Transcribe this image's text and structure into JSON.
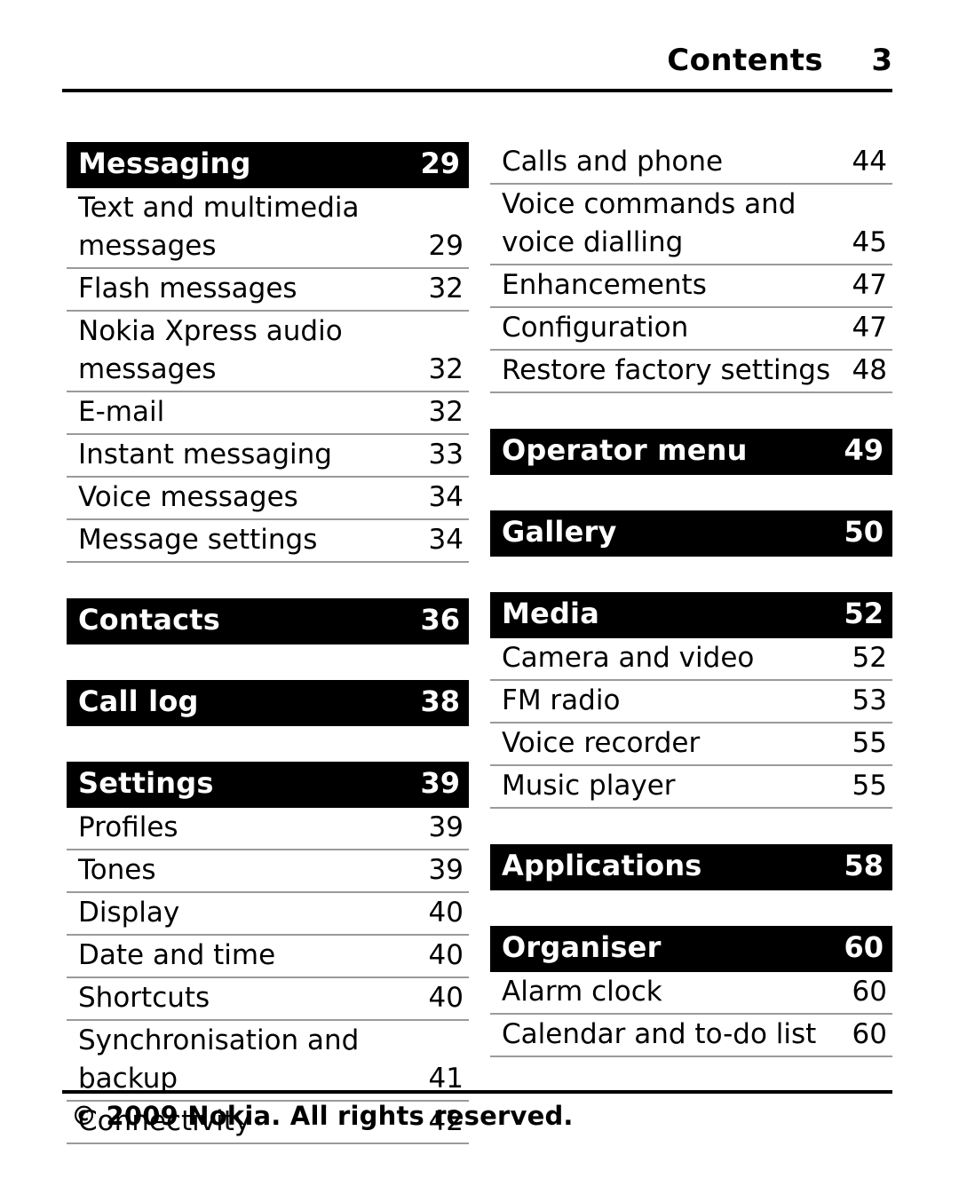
{
  "header": {
    "title": "Contents",
    "page_number": "3"
  },
  "columns": [
    {
      "name": "left-column",
      "groups": [
        {
          "chapter": {
            "label": "Messaging",
            "page": "29"
          },
          "entries": [
            {
              "label": "Text and multimedia messages",
              "page": "29"
            },
            {
              "label": "Flash messages",
              "page": "32"
            },
            {
              "label": "Nokia Xpress audio messages",
              "page": "32"
            },
            {
              "label": "E-mail",
              "page": "32"
            },
            {
              "label": "Instant messaging",
              "page": "33"
            },
            {
              "label": "Voice messages",
              "page": "34"
            },
            {
              "label": "Message settings",
              "page": "34"
            }
          ]
        },
        {
          "chapter": {
            "label": "Contacts",
            "page": "36"
          },
          "entries": []
        },
        {
          "chapter": {
            "label": "Call log",
            "page": "38"
          },
          "entries": []
        },
        {
          "chapter": {
            "label": "Settings",
            "page": "39"
          },
          "entries": [
            {
              "label": "Profiles",
              "page": "39"
            },
            {
              "label": "Tones",
              "page": "39"
            },
            {
              "label": "Display",
              "page": "40"
            },
            {
              "label": "Date and time",
              "page": "40"
            },
            {
              "label": "Shortcuts",
              "page": "40"
            },
            {
              "label": "Synchronisation and backup",
              "page": "41"
            },
            {
              "label": "Connectivity",
              "page": "42"
            }
          ]
        }
      ]
    },
    {
      "name": "right-column",
      "groups": [
        {
          "chapter": null,
          "entries": [
            {
              "label": "Calls and phone",
              "page": "44"
            },
            {
              "label": "Voice commands and voice dialling",
              "page": "45"
            },
            {
              "label": "Enhancements",
              "page": "47"
            },
            {
              "label": "Configuration",
              "page": "47"
            },
            {
              "label": "Restore factory settings",
              "page": "48"
            }
          ]
        },
        {
          "chapter": {
            "label": "Operator menu",
            "page": "49"
          },
          "entries": []
        },
        {
          "chapter": {
            "label": "Gallery",
            "page": "50"
          },
          "entries": []
        },
        {
          "chapter": {
            "label": "Media",
            "page": "52"
          },
          "entries": [
            {
              "label": "Camera and video",
              "page": "52"
            },
            {
              "label": "FM radio",
              "page": "53"
            },
            {
              "label": "Voice recorder",
              "page": "55"
            },
            {
              "label": "Music player",
              "page": "55"
            }
          ]
        },
        {
          "chapter": {
            "label": "Applications",
            "page": "58"
          },
          "entries": []
        },
        {
          "chapter": {
            "label": "Organiser",
            "page": "60"
          },
          "entries": [
            {
              "label": "Alarm clock",
              "page": "60"
            },
            {
              "label": "Calendar and to-do list",
              "page": "60"
            }
          ]
        }
      ]
    }
  ],
  "footer": {
    "copyright": "© 2009 Nokia. All rights reserved."
  }
}
